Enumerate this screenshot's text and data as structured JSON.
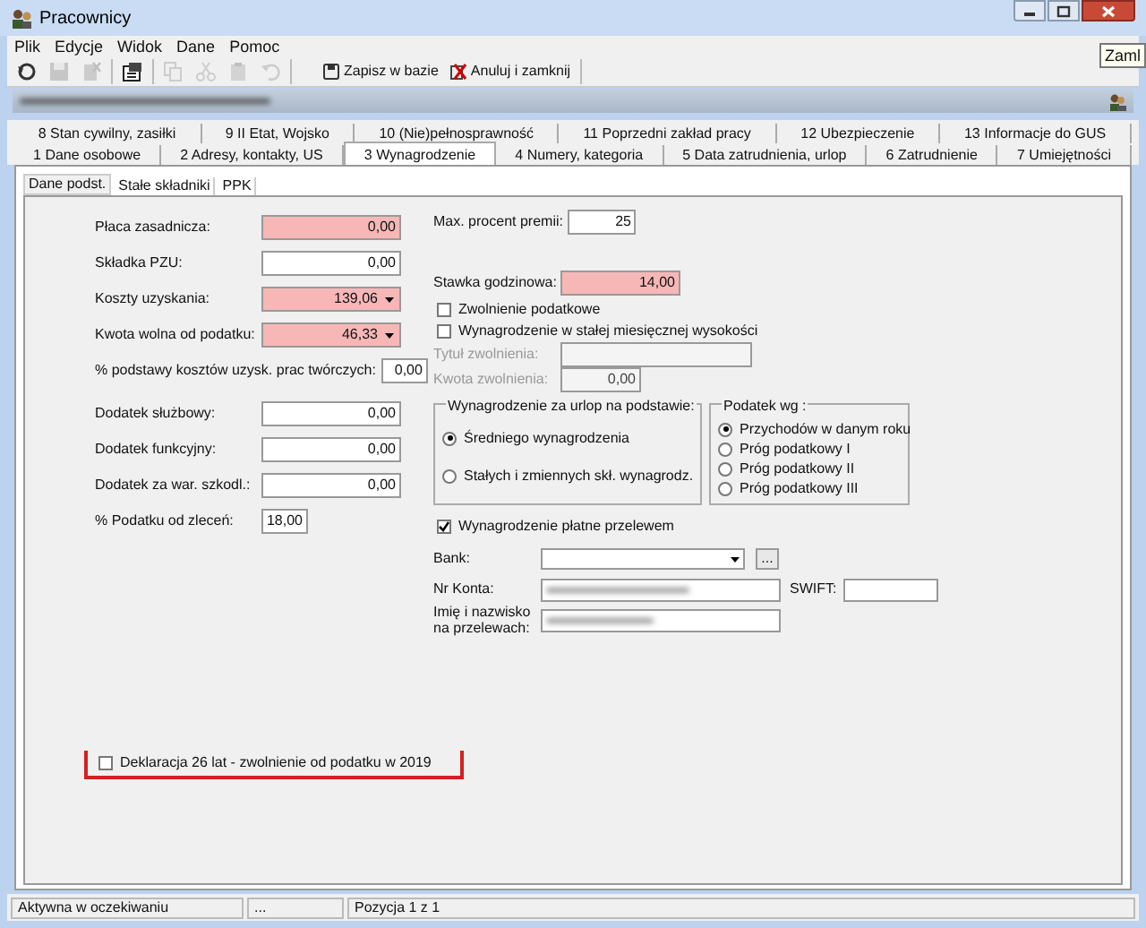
{
  "window": {
    "title": "Pracownicy"
  },
  "tooltip": "Zaml",
  "menu": [
    "Plik",
    "Edycje",
    "Widok",
    "Dane",
    "Pomoc"
  ],
  "toolbar": {
    "icons": [
      {
        "kind": "refresh",
        "disabled": false
      },
      {
        "kind": "save",
        "disabled": true
      },
      {
        "kind": "delete",
        "disabled": true
      },
      {
        "kind": "properties",
        "disabled": false
      },
      {
        "kind": "copy",
        "disabled": true
      },
      {
        "kind": "cut",
        "disabled": true
      },
      {
        "kind": "paste",
        "disabled": true
      },
      {
        "kind": "undo",
        "disabled": true
      }
    ],
    "buttons": [
      {
        "kind": "save",
        "label": "Zapisz w bazie"
      },
      {
        "kind": "cancel",
        "label": "Anuluj i zamknij"
      }
    ]
  },
  "tabs_row_1": [
    {
      "label": "8 Stan cywilny, zasiłki",
      "selected": false
    },
    {
      "label": "9 II Etat, Wojsko",
      "selected": false
    },
    {
      "label": "10 (Nie)pełnosprawność",
      "selected": false
    },
    {
      "label": "11 Poprzedni zakład pracy",
      "selected": false
    },
    {
      "label": "12 Ubezpieczenie",
      "selected": false
    },
    {
      "label": "13 Informacje do GUS",
      "selected": false
    }
  ],
  "tabs_row_2": [
    {
      "label": "1 Dane osobowe",
      "selected": false
    },
    {
      "label": "2 Adresy, kontakty, US",
      "selected": false
    },
    {
      "label": "3 Wynagrodzenie",
      "selected": true
    },
    {
      "label": "4 Numery, kategoria",
      "selected": false
    },
    {
      "label": "5 Data zatrudnienia, urlop",
      "selected": false
    },
    {
      "label": "6 Zatrudnienie",
      "selected": false
    },
    {
      "label": "7 Umiejętności",
      "selected": false
    }
  ],
  "sub_tabs": [
    {
      "label": "Dane podst.",
      "selected": true
    },
    {
      "label": "Stałe składniki",
      "selected": false
    },
    {
      "label": "PPK",
      "selected": false
    }
  ],
  "left_fields": [
    {
      "kind": "wide",
      "label": "Płaca zasadnicza:",
      "value": "0,00",
      "required": true,
      "dropdown": false
    },
    {
      "kind": "wide",
      "label": "Składka PZU:",
      "value": "0,00",
      "required": false,
      "dropdown": false
    },
    {
      "kind": "wide",
      "label": "Koszty uzyskania:",
      "value": "139,06",
      "required": true,
      "dropdown": true
    },
    {
      "kind": "wide",
      "label": "Kwota wolna od podatku:",
      "value": "46,33",
      "required": true,
      "dropdown": true
    },
    {
      "kind": "inline",
      "label": "% podstawy kosztów uzysk. prac twórczych:",
      "value": "0,00",
      "required": false,
      "dropdown": false
    },
    {
      "kind": "wide",
      "label": "Dodatek służbowy:",
      "value": "0,00",
      "required": false,
      "dropdown": false
    },
    {
      "kind": "wide",
      "label": "Dodatek funkcyjny:",
      "value": "0,00",
      "required": false,
      "dropdown": false
    },
    {
      "kind": "wide",
      "label": "Dodatek za war. szkodl.:",
      "value": "0,00",
      "required": false,
      "dropdown": false
    },
    {
      "kind": "short",
      "label": "% Podatku od zleceń:",
      "value": "18,00",
      "required": false,
      "dropdown": false
    }
  ],
  "max_premia": {
    "label": "Max. procent premii:",
    "value": "25"
  },
  "stawka": {
    "label": "Stawka godzinowa:",
    "value": "14,00",
    "required": true
  },
  "checkboxes": [
    {
      "label": "Zwolnienie podatkowe",
      "checked": false
    },
    {
      "label": "Wynagrodzenie w stałej miesięcznej wysokości",
      "checked": false
    }
  ],
  "exemption_fields": [
    {
      "label": "Tytuł zwolnienia:",
      "disabled": true
    },
    {
      "label": "Kwota zwolnienia:",
      "value": "0,00",
      "disabled": true
    }
  ],
  "urlop_group": {
    "title": "Wynagrodzenie za urlop na podstawie:",
    "options": [
      {
        "label": "Średniego wynagrodzenia",
        "selected": true
      },
      {
        "label": "Stałych i zmiennych skł. wynagrodz.",
        "selected": false
      }
    ]
  },
  "podatek_group": {
    "title": "Podatek wg :",
    "options": [
      {
        "label": "Przychodów w danym roku",
        "selected": true
      },
      {
        "label": "Próg podatkowy I",
        "selected": false
      },
      {
        "label": "Próg podatkowy II",
        "selected": false
      },
      {
        "label": "Próg podatkowy III",
        "selected": false
      }
    ]
  },
  "przelew": {
    "label": "Wynagrodzenie płatne przelewem",
    "checked": true
  },
  "bank": {
    "label": "Bank:",
    "browse": "..."
  },
  "account": {
    "label": "Nr Konta:",
    "swift_label": "SWIFT:"
  },
  "recipient": {
    "label": "Imię i nazwisko\nna przelewach:"
  },
  "declaration": {
    "label": "Deklaracja 26 lat - zwolnienie od podatku w 2019",
    "checked": false
  },
  "status_bar": [
    "Aktywna w oczekiwaniu",
    "...",
    "Pozycja 1 z 1"
  ]
}
